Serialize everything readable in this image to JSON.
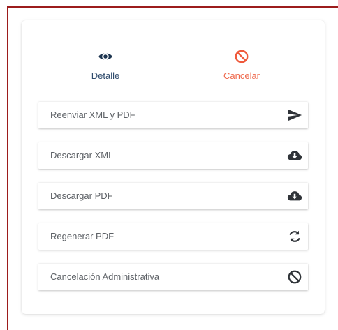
{
  "colors": {
    "frame_border": "#9c1c1c",
    "detail_color": "#2e4a6b",
    "cancel_color": "#ef6a4e",
    "row_text": "#5d6166",
    "icon_dark": "#2f3338"
  },
  "top_actions": {
    "detalle": {
      "label": "Detalle",
      "icon": "eye-icon"
    },
    "cancelar": {
      "label": "Cancelar",
      "icon": "ban-icon"
    }
  },
  "actions": [
    {
      "label": "Reenviar XML y PDF",
      "icon": "send-icon"
    },
    {
      "label": "Descargar XML",
      "icon": "cloud-download-icon"
    },
    {
      "label": "Descargar PDF",
      "icon": "cloud-download-icon"
    },
    {
      "label": "Regenerar PDF",
      "icon": "refresh-icon"
    },
    {
      "label": "Cancelación Administrativa",
      "icon": "ban-icon"
    }
  ]
}
